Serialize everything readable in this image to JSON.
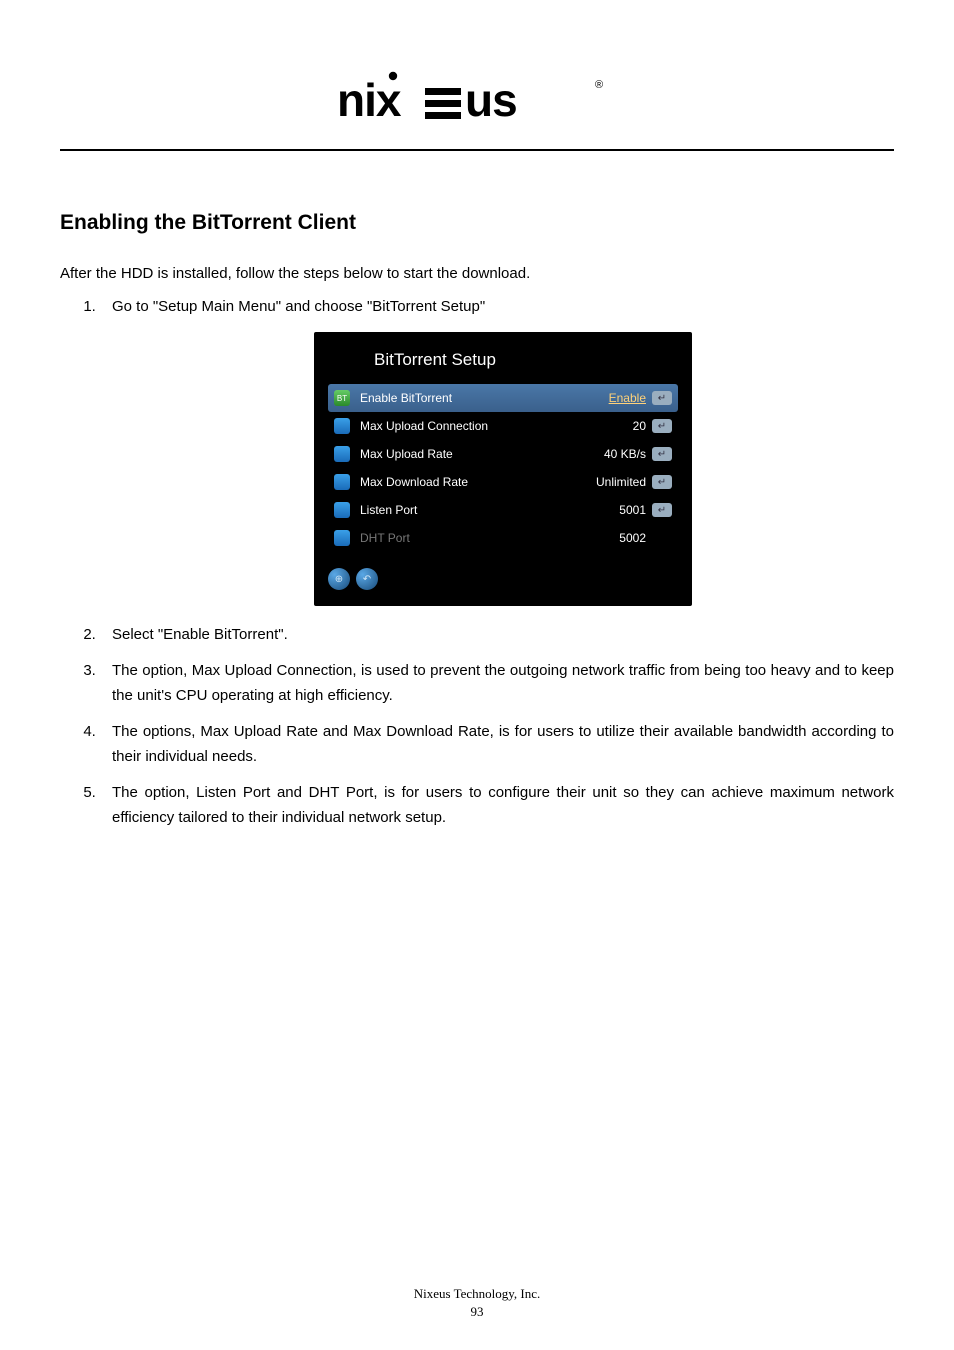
{
  "brand": "nixeus",
  "brand_reg": "®",
  "heading": "Enabling the BitTorrent Client",
  "intro": "After the HDD is installed, follow the steps below to start the download.",
  "steps": [
    "Go to \"Setup Main Menu\" and choose \"BitTorrent Setup\"",
    "Select \"Enable BitTorrent\".",
    "The option, Max Upload Connection, is used to prevent the outgoing network traffic from being too heavy and to keep the unit's CPU operating at high efficiency.",
    "The options, Max Upload Rate and Max Download Rate, is for users to utilize their available bandwidth according to their individual needs.",
    "The option, Listen Port and DHT Port, is for users to configure their unit so they can achieve maximum network efficiency tailored to their individual network setup."
  ],
  "setup": {
    "title": "BitTorrent Setup",
    "rows": [
      {
        "label": "Enable BitTorrent",
        "value": "Enable",
        "selected": true,
        "icon": "bt",
        "disabled": false
      },
      {
        "label": "Max Upload Connection",
        "value": "20",
        "selected": false,
        "icon": "std",
        "disabled": false
      },
      {
        "label": "Max Upload Rate",
        "value": "40 KB/s",
        "selected": false,
        "icon": "std",
        "disabled": false
      },
      {
        "label": "Max Download Rate",
        "value": "Unlimited",
        "selected": false,
        "icon": "std",
        "disabled": false
      },
      {
        "label": "Listen Port",
        "value": "5001",
        "selected": false,
        "icon": "std",
        "disabled": false
      },
      {
        "label": "DHT Port",
        "value": "5002",
        "selected": false,
        "icon": "std",
        "disabled": true
      }
    ]
  },
  "footer": {
    "company": "Nixeus Technology, Inc.",
    "page": "93"
  }
}
